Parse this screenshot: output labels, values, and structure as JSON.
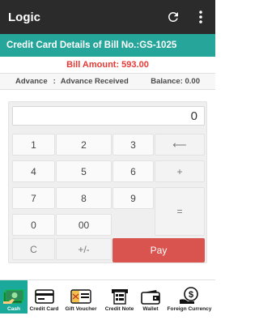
{
  "app": {
    "title": "Logic"
  },
  "header": {
    "title": "Credit Card Details of Bill No.:GS-1025"
  },
  "bill": {
    "amount_text": "Bill Amount: 593.00"
  },
  "advance": {
    "label": "Advance",
    "separator": ":",
    "value": "Advance Received",
    "balance_text": "Balance: 0.00"
  },
  "calculator": {
    "display": "0",
    "keys": {
      "k1": "1",
      "k2": "2",
      "k3": "3",
      "k4": "4",
      "k5": "5",
      "k6": "6",
      "k7": "7",
      "k8": "8",
      "k9": "9",
      "k0": "0",
      "k00": "00",
      "backspace": "⟵",
      "plus": "+",
      "equals": "=",
      "clear": "C",
      "sign": "+/-",
      "pay": "Pay"
    }
  },
  "payment_modes": [
    {
      "label": "Cash",
      "icon": "cash-icon",
      "active": true
    },
    {
      "label": "Credit Card",
      "icon": "credit-card-icon",
      "active": false
    },
    {
      "label": "Gift Voucher",
      "icon": "gift-card-icon",
      "active": false
    },
    {
      "label": "Credit Note",
      "icon": "credit-note-icon",
      "active": false
    },
    {
      "label": "Wallet",
      "icon": "wallet-icon",
      "active": false
    },
    {
      "label": "Foreign Currency",
      "icon": "foreign-currency-icon",
      "active": false
    }
  ],
  "colors": {
    "appbar": "#2b2b2b",
    "header": "#26a69a",
    "amount": "#e53935",
    "pay": "#d9534f",
    "active_tab": "#1aa99a"
  }
}
